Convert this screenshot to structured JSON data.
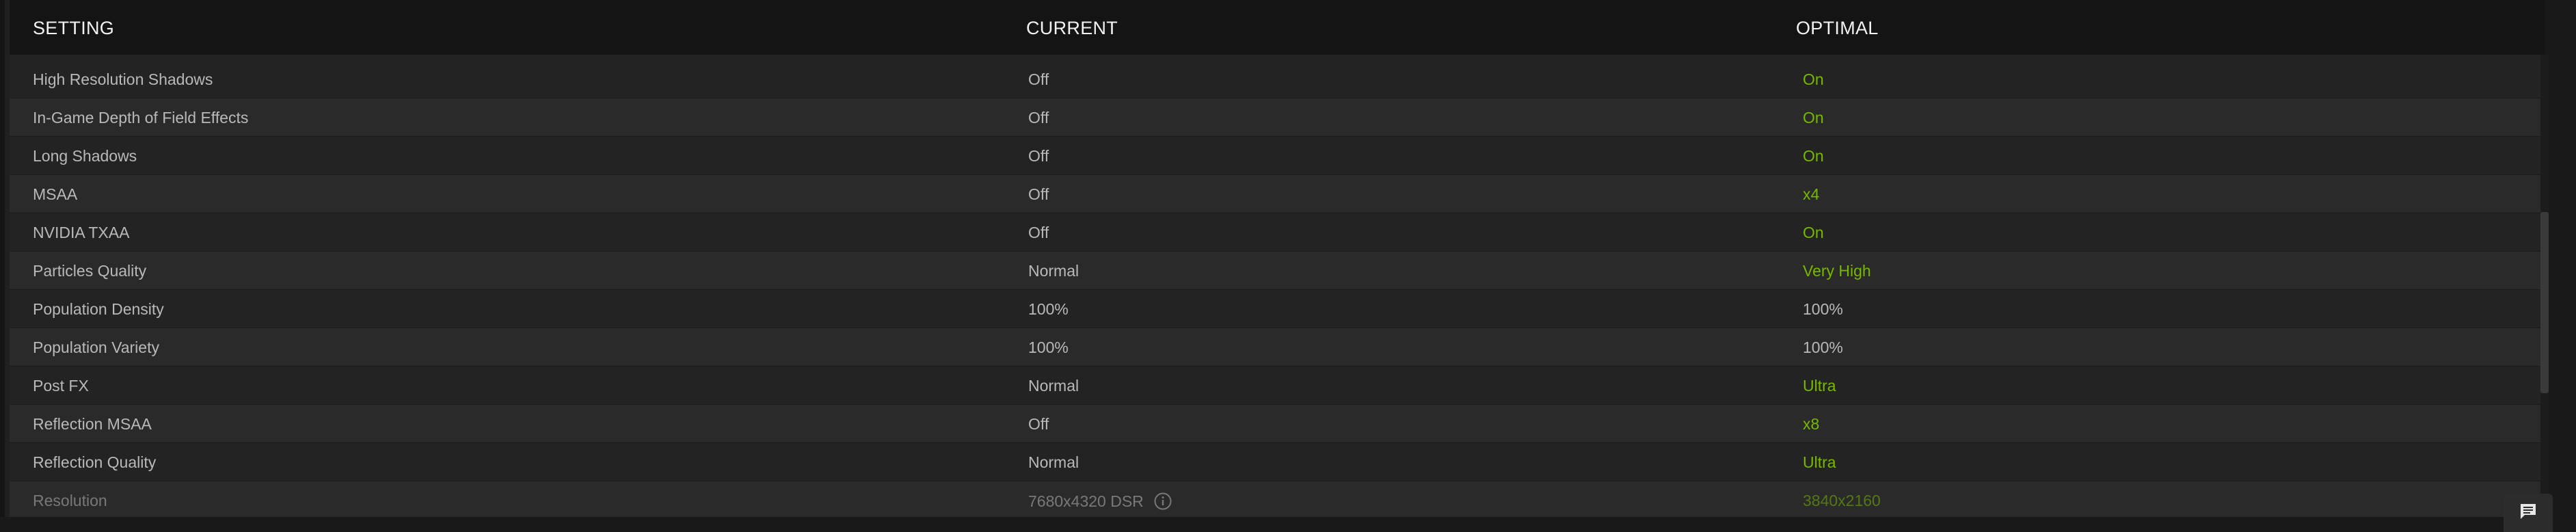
{
  "header": {
    "setting": "SETTING",
    "current": "CURRENT",
    "optimal": "OPTIMAL"
  },
  "rows": [
    {
      "setting": "High Resolution Shadows",
      "current": "Off",
      "optimal": "On",
      "optimal_highlight": true
    },
    {
      "setting": "In-Game Depth of Field Effects",
      "current": "Off",
      "optimal": "On",
      "optimal_highlight": true
    },
    {
      "setting": "Long Shadows",
      "current": "Off",
      "optimal": "On",
      "optimal_highlight": true
    },
    {
      "setting": "MSAA",
      "current": "Off",
      "optimal": "x4",
      "optimal_highlight": true
    },
    {
      "setting": "NVIDIA TXAA",
      "current": "Off",
      "optimal": "On",
      "optimal_highlight": true
    },
    {
      "setting": "Particles Quality",
      "current": "Normal",
      "optimal": "Very High",
      "optimal_highlight": true
    },
    {
      "setting": "Population Density",
      "current": "100%",
      "optimal": "100%",
      "optimal_highlight": false
    },
    {
      "setting": "Population Variety",
      "current": "100%",
      "optimal": "100%",
      "optimal_highlight": false
    },
    {
      "setting": "Post FX",
      "current": "Normal",
      "optimal": "Ultra",
      "optimal_highlight": true
    },
    {
      "setting": "Reflection MSAA",
      "current": "Off",
      "optimal": "x8",
      "optimal_highlight": true
    },
    {
      "setting": "Reflection Quality",
      "current": "Normal",
      "optimal": "Ultra",
      "optimal_highlight": true
    },
    {
      "setting": "Resolution",
      "current": "7680x4320 DSR",
      "optimal": "3840x2160",
      "optimal_highlight": true
    }
  ],
  "colors": {
    "highlight": "#76b900",
    "text": "#b9b9b9",
    "header_text": "#f2f2f2"
  },
  "icons": {
    "info": "info-circle-icon",
    "feedback": "chat-bubble-icon"
  }
}
